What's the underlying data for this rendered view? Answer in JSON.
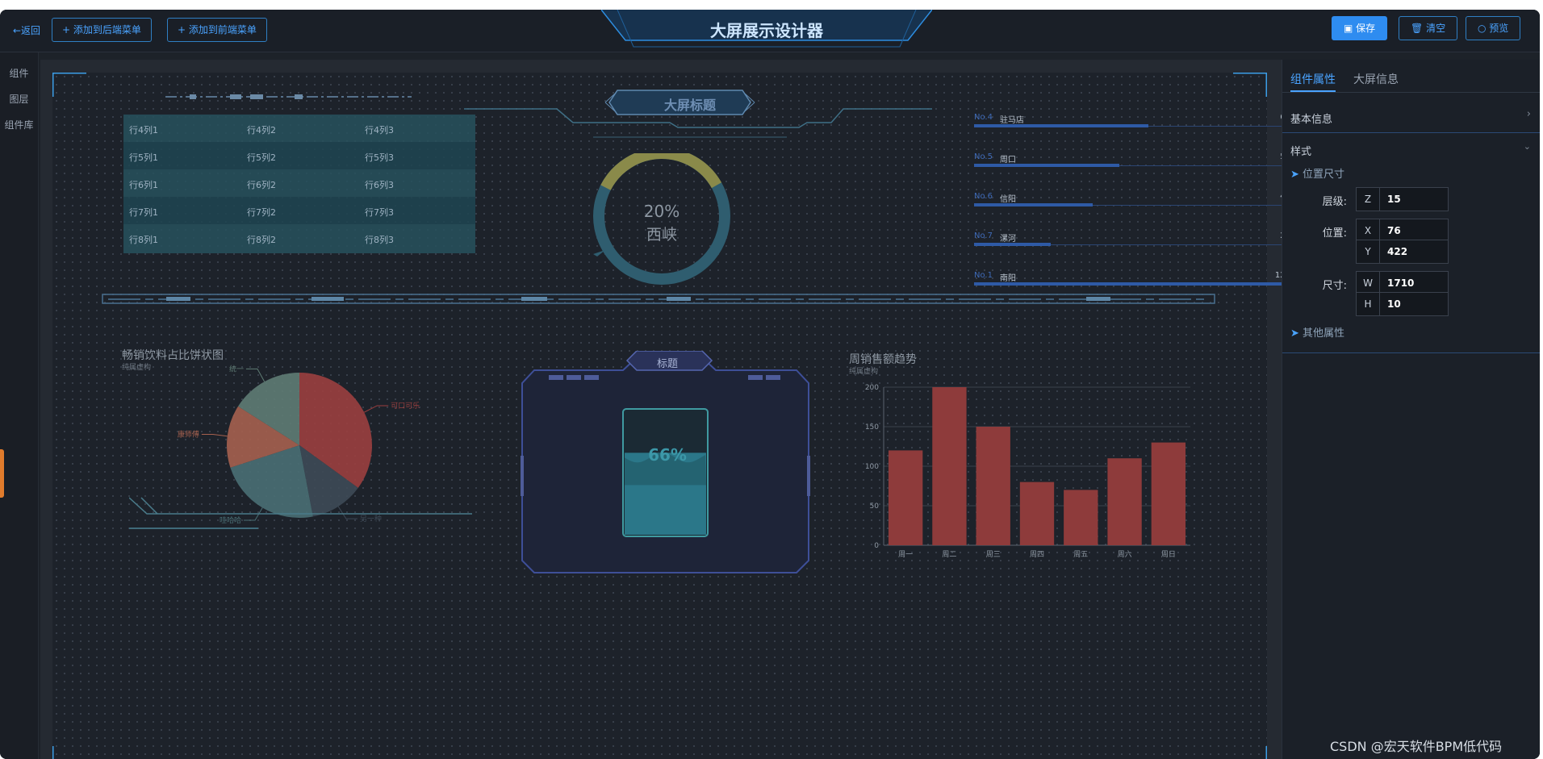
{
  "toolbar": {
    "back": "←返回",
    "add_back": "+ 添加到后端菜单",
    "add_front": "+ 添加到前端菜单",
    "title": "大屏展示设计器",
    "save": "保存",
    "clear": "清空",
    "preview": "预览"
  },
  "leftnav": {
    "items": [
      "组件",
      "图层",
      "组件库"
    ]
  },
  "stage": {
    "screen_title": "大屏标题",
    "table": {
      "rows": [
        [
          "行4列1",
          "行4列2",
          "行4列3"
        ],
        [
          "行5列1",
          "行5列2",
          "行5列3"
        ],
        [
          "行6列1",
          "行6列2",
          "行6列3"
        ],
        [
          "行7列1",
          "行7列2",
          "行7列3"
        ],
        [
          "行8列1",
          "行8列2",
          "行8列3"
        ]
      ]
    },
    "ring": {
      "percent_text": "20%",
      "label": "西峡",
      "value": 0.2
    },
    "ranking": [
      {
        "no": "No.4",
        "name": "驻马店",
        "value": 66
      },
      {
        "no": "No.5",
        "name": "周口",
        "value": 55
      },
      {
        "no": "No.6",
        "name": "信阳",
        "value": 45
      },
      {
        "no": "No.7",
        "name": "漯河",
        "value": 29
      },
      {
        "no": "No.1",
        "name": "南阳",
        "value": 120
      }
    ],
    "pie": {
      "title": "畅销饮料占比饼状图",
      "subtitle": "纯属虚构",
      "slices": [
        {
          "name": "可口可乐",
          "value": 35,
          "color": "#9b3f3f"
        },
        {
          "name": "另一种",
          "value": 12,
          "color": "#3e4a57"
        },
        {
          "name": "哇哈哈",
          "value": 23,
          "color": "#4a6f74"
        },
        {
          "name": "康师傅",
          "value": 14,
          "color": "#a6614f"
        },
        {
          "name": "统一",
          "value": 16,
          "color": "#5f7c74"
        }
      ]
    },
    "water": {
      "title": "标题",
      "percent_text": "66%",
      "value": 0.66
    },
    "bar": {
      "title": "周销售额趋势",
      "subtitle": "纯属虚构"
    }
  },
  "chart_data": {
    "type": "bar",
    "title": "周销售额趋势",
    "subtitle": "纯属虚构",
    "categories": [
      "周一",
      "周二",
      "周三",
      "周四",
      "周五",
      "周六",
      "周日"
    ],
    "values": [
      120,
      200,
      150,
      80,
      70,
      110,
      130
    ],
    "ylim": [
      0,
      200
    ],
    "yticks": [
      0,
      50,
      100,
      150,
      200
    ],
    "color": "#8e3b3b",
    "grid": true
  },
  "rpanel": {
    "tabs": [
      "组件属性",
      "大屏信息"
    ],
    "basic": "基本信息",
    "style": "样式",
    "pos_size": "位置尺寸",
    "layer_label": "层级:",
    "pos_label": "位置:",
    "size_label": "尺寸:",
    "z": {
      "key": "Z",
      "value": "15"
    },
    "x": {
      "key": "X",
      "value": "76"
    },
    "y": {
      "key": "Y",
      "value": "422"
    },
    "w": {
      "key": "W",
      "value": "1710"
    },
    "h": {
      "key": "H",
      "value": "10"
    },
    "other": "其他属性"
  },
  "watermark": "CSDN @宏天软件BPM低代码",
  "colors": {
    "accent": "#2e8cf0",
    "bg": "#1d2229"
  }
}
